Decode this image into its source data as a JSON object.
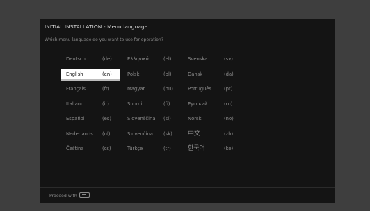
{
  "header": {
    "title": "INITIAL INSTALLATION - Menu language",
    "question": "Which menu language do you want to use for operation?"
  },
  "languages": [
    {
      "name": "Deutsch",
      "code": "(de)",
      "selected": false
    },
    {
      "name": "English",
      "code": "(en)",
      "selected": true
    },
    {
      "name": "Français",
      "code": "(fr)",
      "selected": false
    },
    {
      "name": "Italiano",
      "code": "(it)",
      "selected": false
    },
    {
      "name": "Español",
      "code": "(es)",
      "selected": false
    },
    {
      "name": "Nederlands",
      "code": "(nl)",
      "selected": false
    },
    {
      "name": "Čeština",
      "code": "(cs)",
      "selected": false
    },
    {
      "name": "Ελληνικά",
      "code": "(el)",
      "selected": false
    },
    {
      "name": "Polski",
      "code": "(pl)",
      "selected": false
    },
    {
      "name": "Magyar",
      "code": "(hu)",
      "selected": false
    },
    {
      "name": "Suomi",
      "code": "(fi)",
      "selected": false
    },
    {
      "name": "Slovenščina",
      "code": "(sl)",
      "selected": false
    },
    {
      "name": "Slovenčina",
      "code": "(sk)",
      "selected": false
    },
    {
      "name": "Türkçe",
      "code": "(tr)",
      "selected": false
    },
    {
      "name": "Svenska",
      "code": "(sv)",
      "selected": false
    },
    {
      "name": "Dansk",
      "code": "(da)",
      "selected": false
    },
    {
      "name": "Português",
      "code": "(pt)",
      "selected": false
    },
    {
      "name": "Русский",
      "code": "(ru)",
      "selected": false
    },
    {
      "name": "Norsk",
      "code": "(no)",
      "selected": false
    },
    {
      "name": "中文",
      "code": "(zh)",
      "selected": false
    },
    {
      "name": "한국어",
      "code": "(ko)",
      "selected": false
    }
  ],
  "footer": {
    "label": "Proceed with",
    "key_icon": "ok-key-icon"
  },
  "colors": {
    "background": "#3e3e3e",
    "screen": "#141414",
    "text": "#8c8c8c",
    "selected_bg": "#ffffff",
    "selected_text": "#0b0b0b"
  }
}
